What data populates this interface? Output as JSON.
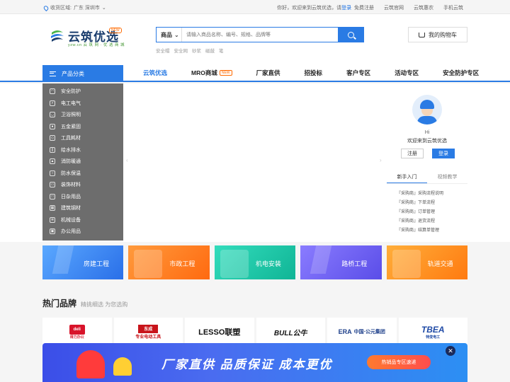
{
  "topbar": {
    "location_label": "收货区域:",
    "location_value": "广东  深圳市",
    "welcome": "你好，欢迎来到云筑优选，请",
    "login": "登录",
    "register": "免费注册",
    "links": [
      "云筑官网",
      "云筑惠农",
      "手机云筑"
    ]
  },
  "logo": {
    "name": "云筑优选",
    "sub": "yzw.cn 云 筑 网 · 优 选 商 城",
    "badge": "NEW"
  },
  "search": {
    "category": "商品",
    "placeholder": "请输入商品名称、编号、规格、品牌等",
    "hotwords": [
      "安全帽",
      "安全网",
      "砂浆",
      "磁鼓",
      "笔"
    ]
  },
  "cart": {
    "label": "我的购物车"
  },
  "nav": {
    "category_head": "产品分类",
    "items": [
      {
        "label": "云筑优选",
        "active": true
      },
      {
        "label": "MRO商城",
        "tag": "NEW"
      },
      {
        "label": "厂家直供"
      },
      {
        "label": "招投标"
      },
      {
        "label": "客户专区"
      },
      {
        "label": "活动专区"
      },
      {
        "label": "安全防护专区"
      }
    ]
  },
  "side_menu": [
    {
      "label": "安全防护",
      "icon": "helmet-icon"
    },
    {
      "label": "电工电气",
      "icon": "plug-icon"
    },
    {
      "label": "卫浴照明",
      "icon": "lamp-icon"
    },
    {
      "label": "五金紧固",
      "icon": "bolt-icon"
    },
    {
      "label": "工具耗材",
      "icon": "tool-icon"
    },
    {
      "label": "给水排水",
      "icon": "pipe-icon"
    },
    {
      "label": "消防暖通",
      "icon": "fire-icon"
    },
    {
      "label": "防水保温",
      "icon": "drop-icon"
    },
    {
      "label": "装饰材料",
      "icon": "brush-icon"
    },
    {
      "label": "日杂用品",
      "icon": "bag-icon"
    },
    {
      "label": "建筑钢材",
      "icon": "steel-icon"
    },
    {
      "label": "机械设备",
      "icon": "gear-icon"
    },
    {
      "label": "办公用品",
      "icon": "printer-icon"
    }
  ],
  "user_box": {
    "hi": "Hi",
    "welcome": "欢迎来到云筑优选",
    "register": "注册",
    "login": "登录",
    "tabs": [
      "新手入门",
      "视频教学"
    ],
    "guides": [
      "『采购商』采购流程说明",
      "『采购商』下单流程",
      "『采购商』订单管理",
      "『采购商』退货流程",
      "『采购商』结算单管理"
    ]
  },
  "tiles": [
    {
      "label": "房建工程",
      "color": "#2f7ff0"
    },
    {
      "label": "市政工程",
      "color": "#ff7a1a"
    },
    {
      "label": "机电安装",
      "color": "#19c7a6"
    },
    {
      "label": "路桥工程",
      "color": "#6a5cf0"
    },
    {
      "label": "轨道交通",
      "color": "#ff8a1f"
    }
  ],
  "brands": {
    "title": "热门品牌",
    "subtitle": "精挑细选 为您选购",
    "items": [
      "deli",
      "东成",
      "LESSO联塑",
      "BULL公牛",
      "中国·公元集团",
      "TBEA"
    ],
    "details": {
      "deli_sub": "得力办公",
      "dc_sub": "专业电动工具",
      "era_mark": "ERA",
      "tben_sub": "特变电工"
    }
  },
  "promo": {
    "slogan": "厂家直供  品质保证  成本更优",
    "cta": "热销品专区速递",
    "close": "✕"
  },
  "colors": {
    "primary": "#2a7be4",
    "accent": "#ff6a00"
  }
}
